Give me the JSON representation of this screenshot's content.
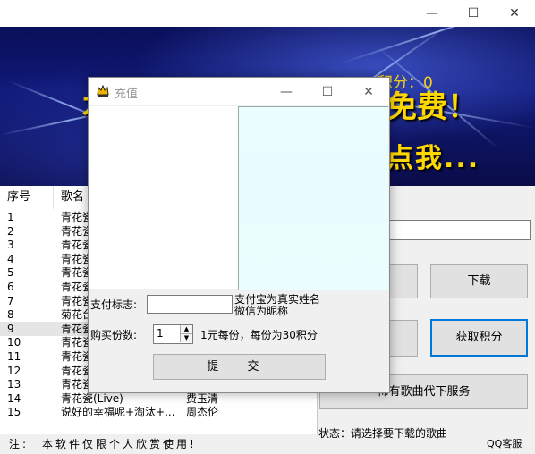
{
  "window": {
    "minimize": "—",
    "maximize": "☐",
    "close": "✕"
  },
  "banner": {
    "score": "积分：0",
    "text_left": "本",
    "text_right_1": "免费！",
    "text_right_2": "点我..."
  },
  "list": {
    "headers": [
      "序号",
      "歌名"
    ],
    "rows": [
      {
        "no": "1",
        "name": "青花瓷",
        "artist": ""
      },
      {
        "no": "2",
        "name": "青花瓷",
        "artist": ""
      },
      {
        "no": "3",
        "name": "青花瓷",
        "artist": ""
      },
      {
        "no": "4",
        "name": "青花瓷",
        "artist": ""
      },
      {
        "no": "5",
        "name": "青花瓷",
        "artist": ""
      },
      {
        "no": "6",
        "name": "青花瓷",
        "artist": ""
      },
      {
        "no": "7",
        "name": "青花瓷",
        "artist": ""
      },
      {
        "no": "8",
        "name": "菊花台",
        "artist": ""
      },
      {
        "no": "9",
        "name": "青花瓷",
        "artist": ""
      },
      {
        "no": "10",
        "name": "青花瓷",
        "artist": ""
      },
      {
        "no": "11",
        "name": "青花瓷",
        "artist": ""
      },
      {
        "no": "12",
        "name": "青花瓷",
        "artist": ""
      },
      {
        "no": "13",
        "name": "青花瓷",
        "artist": ""
      },
      {
        "no": "14",
        "name": "青花瓷(Live)",
        "artist": "费玉清"
      },
      {
        "no": "15",
        "name": "说好的幸福呢+淘汰+...",
        "artist": "周杰伦"
      }
    ],
    "selected_index": 8
  },
  "right": {
    "download": "下载",
    "get_points": "获取积分",
    "service": "稀有歌曲代下服务",
    "status": "状态：请选择要下载的歌曲",
    "qq": "QQ客服"
  },
  "note": "注:　本软件仅限个人欣赏使用!",
  "dialog": {
    "title": "充值",
    "minimize": "—",
    "maximize": "☐",
    "close": "✕",
    "pay_label": "支付标志:",
    "pay_hint_1": "支付宝为真实姓名",
    "pay_hint_2": "微信为昵称",
    "qty_label": "购买份数:",
    "qty_value": "1",
    "price_info": "1元每份，每份为30积分",
    "submit": "提 交"
  }
}
